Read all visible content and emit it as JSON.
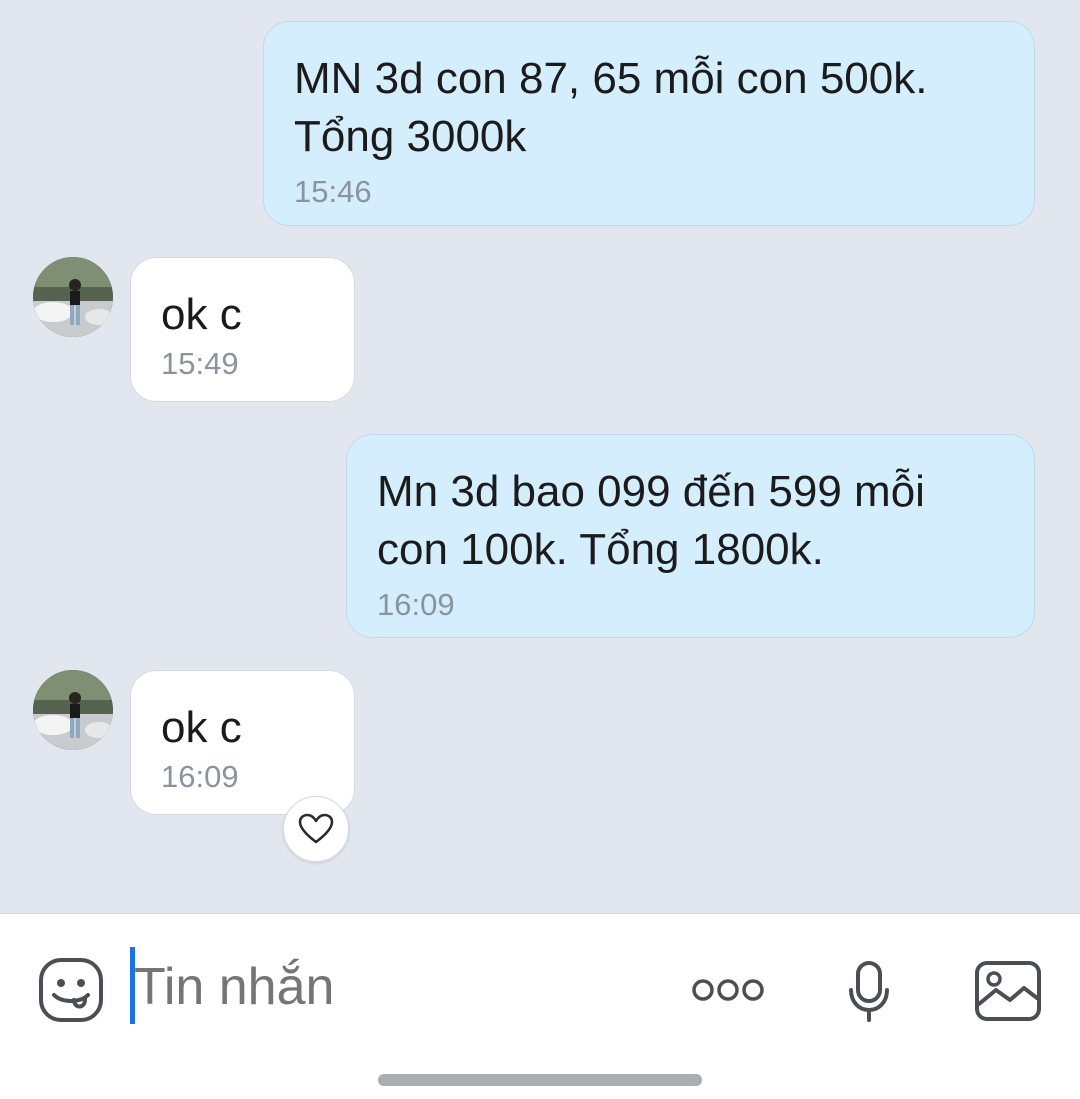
{
  "messages": [
    {
      "direction": "out",
      "text": "MN 3d con 87, 65 mỗi con 500k.\nTổng 3000k",
      "time": "15:46"
    },
    {
      "direction": "in",
      "text": "ok c",
      "time": "15:49"
    },
    {
      "direction": "out",
      "text": "Mn 3d bao 099 đến 599 mỗi\ncon 100k. Tổng 1800k.",
      "time": "16:09"
    },
    {
      "direction": "in",
      "text": "ok c",
      "time": "16:09"
    }
  ],
  "composer": {
    "placeholder": "Tin nhắn"
  },
  "icons": {
    "sticker": "sticker-face-icon",
    "more": "more-dots-icon",
    "voice": "microphone-icon",
    "gallery": "image-gallery-icon",
    "reaction": "heart-icon"
  },
  "colors": {
    "background": "#e2e7ef",
    "outgoing_bubble": "#d5eefd",
    "incoming_bubble": "#ffffff",
    "time_text": "#8b949e",
    "cursor": "#1a73e8"
  }
}
